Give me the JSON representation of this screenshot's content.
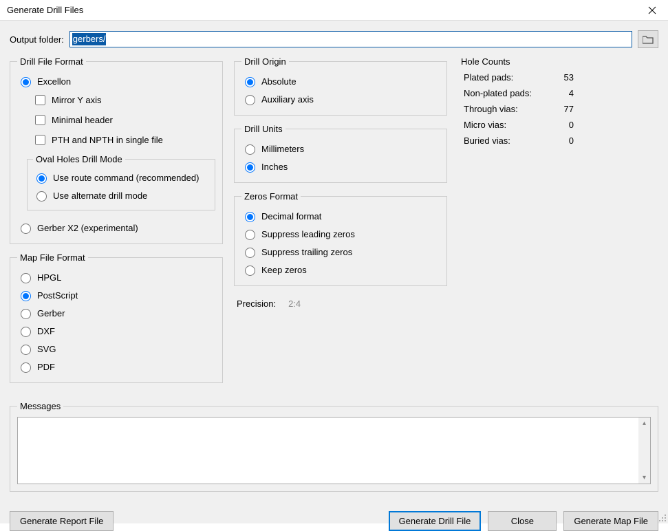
{
  "window": {
    "title": "Generate Drill Files"
  },
  "output_folder": {
    "label": "Output folder:",
    "value": "gerbers/"
  },
  "drill_file_format": {
    "legend": "Drill File Format",
    "excellon_label": "Excellon",
    "mirror_y": "Mirror Y axis",
    "minimal_header": "Minimal header",
    "pth_single": "PTH and NPTH in single file",
    "oval_legend": "Oval Holes Drill Mode",
    "oval_route": "Use route command (recommended)",
    "oval_alt": "Use alternate drill mode",
    "gerber_x2": "Gerber X2 (experimental)"
  },
  "map_file_format": {
    "legend": "Map File Format",
    "hpgl": "HPGL",
    "postscript": "PostScript",
    "gerber": "Gerber",
    "dxf": "DXF",
    "svg": "SVG",
    "pdf": "PDF"
  },
  "drill_origin": {
    "legend": "Drill Origin",
    "absolute": "Absolute",
    "auxiliary": "Auxiliary axis"
  },
  "drill_units": {
    "legend": "Drill Units",
    "mm": "Millimeters",
    "in": "Inches"
  },
  "zeros_format": {
    "legend": "Zeros Format",
    "decimal": "Decimal format",
    "suppress_leading": "Suppress leading zeros",
    "suppress_trailing": "Suppress trailing zeros",
    "keep": "Keep zeros"
  },
  "precision": {
    "label": "Precision:",
    "value": "2:4"
  },
  "hole_counts": {
    "legend": "Hole Counts",
    "rows": [
      {
        "label": "Plated pads:",
        "value": "53"
      },
      {
        "label": "Non-plated pads:",
        "value": "4"
      },
      {
        "label": "Through vias:",
        "value": "77"
      },
      {
        "label": "Micro vias:",
        "value": "0"
      },
      {
        "label": "Buried vias:",
        "value": "0"
      }
    ]
  },
  "messages": {
    "legend": "Messages"
  },
  "buttons": {
    "generate_report": "Generate Report File",
    "generate_drill": "Generate Drill File",
    "close": "Close",
    "generate_map": "Generate Map File"
  }
}
